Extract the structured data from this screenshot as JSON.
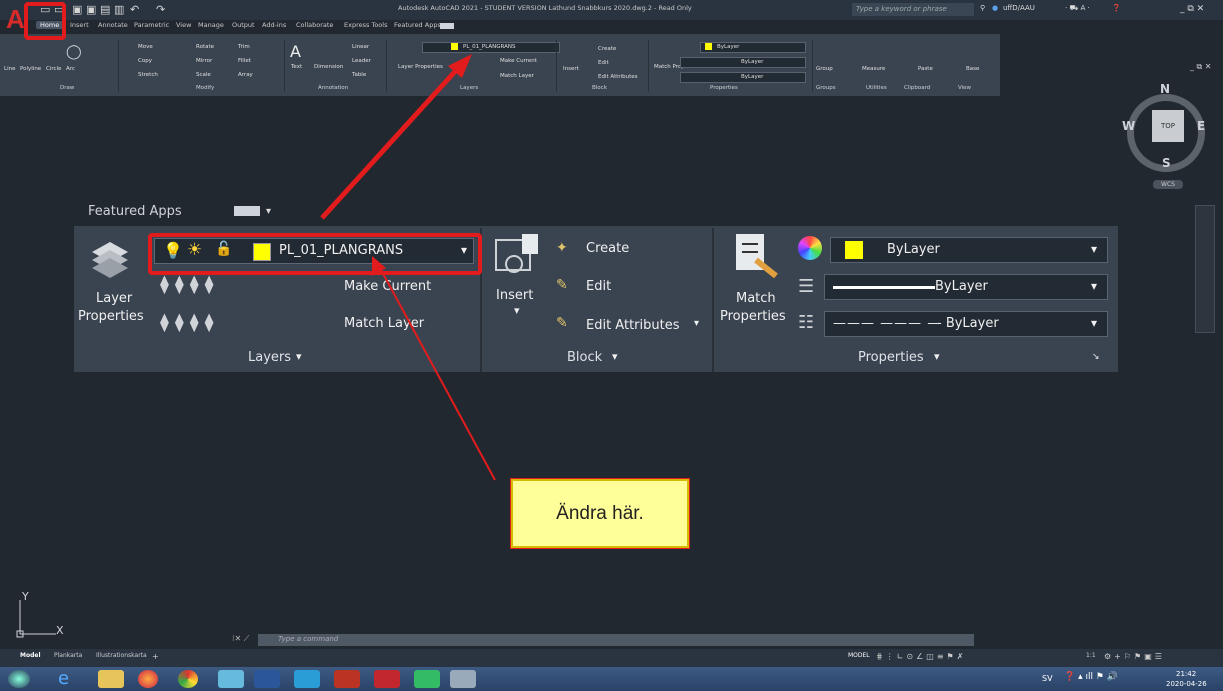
{
  "titlebar": {
    "title": "Autodesk AutoCAD 2021 - STUDENT VERSION   Lathund Snabbkurs 2020.dwg.2 - Read Only",
    "search_placeholder": "Type a keyword or phrase",
    "user": "uffD/AAU"
  },
  "menu_tabs": [
    "Home",
    "Insert",
    "Annotate",
    "Parametric",
    "View",
    "Manage",
    "Output",
    "Add-ins",
    "Collaborate",
    "Express Tools",
    "Featured Apps"
  ],
  "ribbon": {
    "draw": {
      "buttons": [
        "Line",
        "Polyline",
        "Circle",
        "Arc"
      ],
      "label": "Draw"
    },
    "modify": {
      "buttons": [
        "Move",
        "Rotate",
        "Trim",
        "Copy",
        "Mirror",
        "Fillet",
        "Stretch",
        "Scale",
        "Array"
      ],
      "label": "Modify"
    },
    "annotation": {
      "buttons": [
        "Text",
        "Dimension",
        "Linear",
        "Leader",
        "Table"
      ],
      "label": "Annotation"
    },
    "layers": {
      "current_layer": "PL_01_PLANGRANS",
      "layer_properties": "Layer Properties",
      "make_current": "Make Current",
      "match_layer": "Match Layer",
      "label": "Layers"
    },
    "block": {
      "insert": "Insert",
      "create": "Create",
      "edit": "Edit",
      "edit_attributes": "Edit Attributes",
      "label": "Block"
    },
    "properties": {
      "match": "Match Properties",
      "color": "ByLayer",
      "lineweight": "ByLayer",
      "linetype": "ByLayer",
      "label": "Properties"
    },
    "groups": {
      "group": "Group",
      "label": "Groups"
    },
    "utilities": {
      "measure": "Measure",
      "label": "Utilities"
    },
    "clipboard": {
      "paste": "Paste",
      "label": "Clipboard"
    },
    "view": {
      "base": "Base",
      "label": "View"
    }
  },
  "zoom_panel": {
    "featured_apps": "Featured Apps",
    "layer_properties_line1": "Layer",
    "layer_properties_line2": "Properties",
    "current_layer": "PL_01_PLANGRANS",
    "make_current": "Make Current",
    "match_layer": "Match Layer",
    "layers_label": "Layers",
    "insert": "Insert",
    "create": "Create",
    "edit": "Edit",
    "edit_attributes": "Edit Attributes",
    "block_label": "Block",
    "match_line1": "Match",
    "match_line2": "Properties",
    "color": "ByLayer",
    "lineweight": "ByLayer",
    "linetype": "- ByLayer",
    "properties_label": "Properties"
  },
  "annotation_note": "Ändra här.",
  "viewcube": {
    "n": "N",
    "s": "S",
    "w": "W",
    "e": "E",
    "top": "TOP",
    "wcs": "WCS"
  },
  "axes": {
    "x": "X",
    "y": "Y"
  },
  "command_placeholder": "Type a command",
  "layout_tabs": [
    "Model",
    "Plankarta",
    "Illustrationskarta"
  ],
  "status": {
    "model": "MODEL",
    "scale": "1:1"
  },
  "taskbar": {
    "lang": "SV",
    "time": "21:42",
    "date": "2020-04-26"
  },
  "colors": {
    "accent_red": "#e21c1c",
    "layer_yellow": "#ffff00",
    "note_fill": "#ffff99"
  }
}
